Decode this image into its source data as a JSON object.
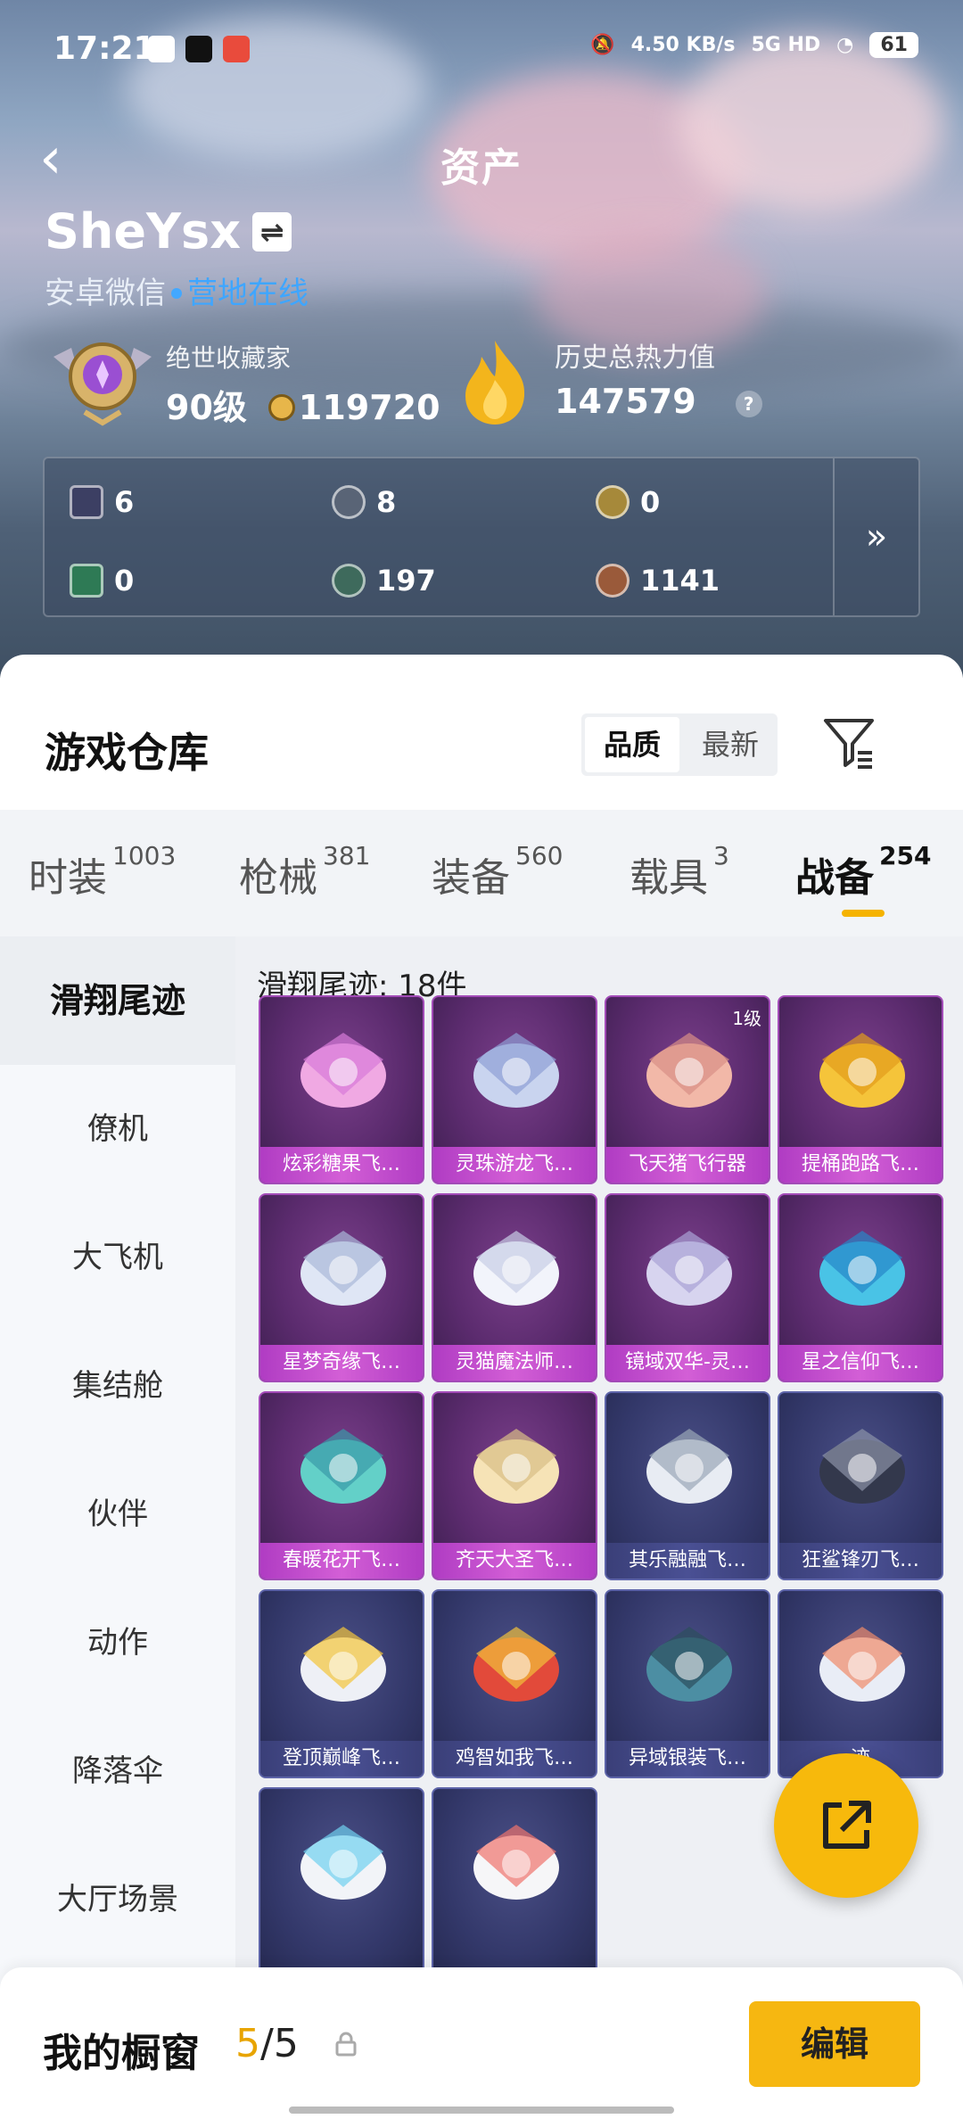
{
  "status": {
    "time": "17:21",
    "net_speed": "4.50 KB/s",
    "net_type": "5G HD",
    "battery": "61"
  },
  "nav": {
    "title": "资产",
    "back_icon": "chevron-left-icon"
  },
  "user": {
    "name": "SheYsx",
    "platform": "安卓微信",
    "online": "营地在线"
  },
  "stats": {
    "collector_title": "绝世收藏家",
    "collector_level": "90级",
    "collector_points": "119720",
    "heat_label": "历史总热力值",
    "heat_value": "147579",
    "help": "?"
  },
  "currency": [
    {
      "icon": "card-icon",
      "value": "6"
    },
    {
      "icon": "silver-coin-icon",
      "value": "8"
    },
    {
      "icon": "gold-badge-icon",
      "value": "0"
    },
    {
      "icon": "green-card-icon",
      "value": "0"
    },
    {
      "icon": "gem-icon",
      "value": "197"
    },
    {
      "icon": "bronze-coin-icon",
      "value": "1141"
    }
  ],
  "warehouse": {
    "title": "游戏仓库",
    "sort": [
      "品质",
      "最新"
    ],
    "tabs": [
      {
        "label": "时装",
        "count": "1003"
      },
      {
        "label": "枪械",
        "count": "381"
      },
      {
        "label": "装备",
        "count": "560"
      },
      {
        "label": "载具",
        "count": "3"
      },
      {
        "label": "战备",
        "count": "254"
      }
    ],
    "sidebar": [
      "滑翔尾迹",
      "僚机",
      "大飞机",
      "集结舱",
      "伙伴",
      "动作",
      "降落伞",
      "大厅场景"
    ],
    "section_title": "滑翔尾迹: 18件",
    "items": [
      {
        "name": "炫彩糖果飞…",
        "rarity": "purple",
        "level": ""
      },
      {
        "name": "灵珠游龙飞…",
        "rarity": "purple",
        "level": ""
      },
      {
        "name": "飞天猪飞行器",
        "rarity": "purple",
        "level": "1级"
      },
      {
        "name": "提桶跑路飞…",
        "rarity": "purple",
        "level": ""
      },
      {
        "name": "星梦奇缘飞…",
        "rarity": "purple",
        "level": ""
      },
      {
        "name": "灵猫魔法师…",
        "rarity": "purple",
        "level": ""
      },
      {
        "name": "镜域双华-灵…",
        "rarity": "purple",
        "level": ""
      },
      {
        "name": "星之信仰飞…",
        "rarity": "purple",
        "level": ""
      },
      {
        "name": "春暖花开飞…",
        "rarity": "purple",
        "level": ""
      },
      {
        "name": "齐天大圣飞…",
        "rarity": "purple",
        "level": ""
      },
      {
        "name": "其乐融融飞…",
        "rarity": "blue",
        "level": ""
      },
      {
        "name": "狂鲨锋刃飞…",
        "rarity": "blue",
        "level": ""
      },
      {
        "name": "登顶巅峰飞…",
        "rarity": "blue",
        "level": ""
      },
      {
        "name": "鸡智如我飞…",
        "rarity": "blue",
        "level": ""
      },
      {
        "name": "异域银装飞…",
        "rarity": "blue",
        "level": ""
      },
      {
        "name": "迹",
        "rarity": "blue",
        "level": ""
      },
      {
        "name": "",
        "rarity": "blue",
        "level": ""
      },
      {
        "name": "",
        "rarity": "blue",
        "level": ""
      }
    ]
  },
  "showcase": {
    "label": "我的橱窗",
    "count_current": "5",
    "count_total": "/5",
    "edit": "编辑"
  },
  "colors": {
    "accent": "#f6b711",
    "online": "#3fa6ff",
    "purple": "#a24bb7",
    "blue": "#5c63a8"
  }
}
